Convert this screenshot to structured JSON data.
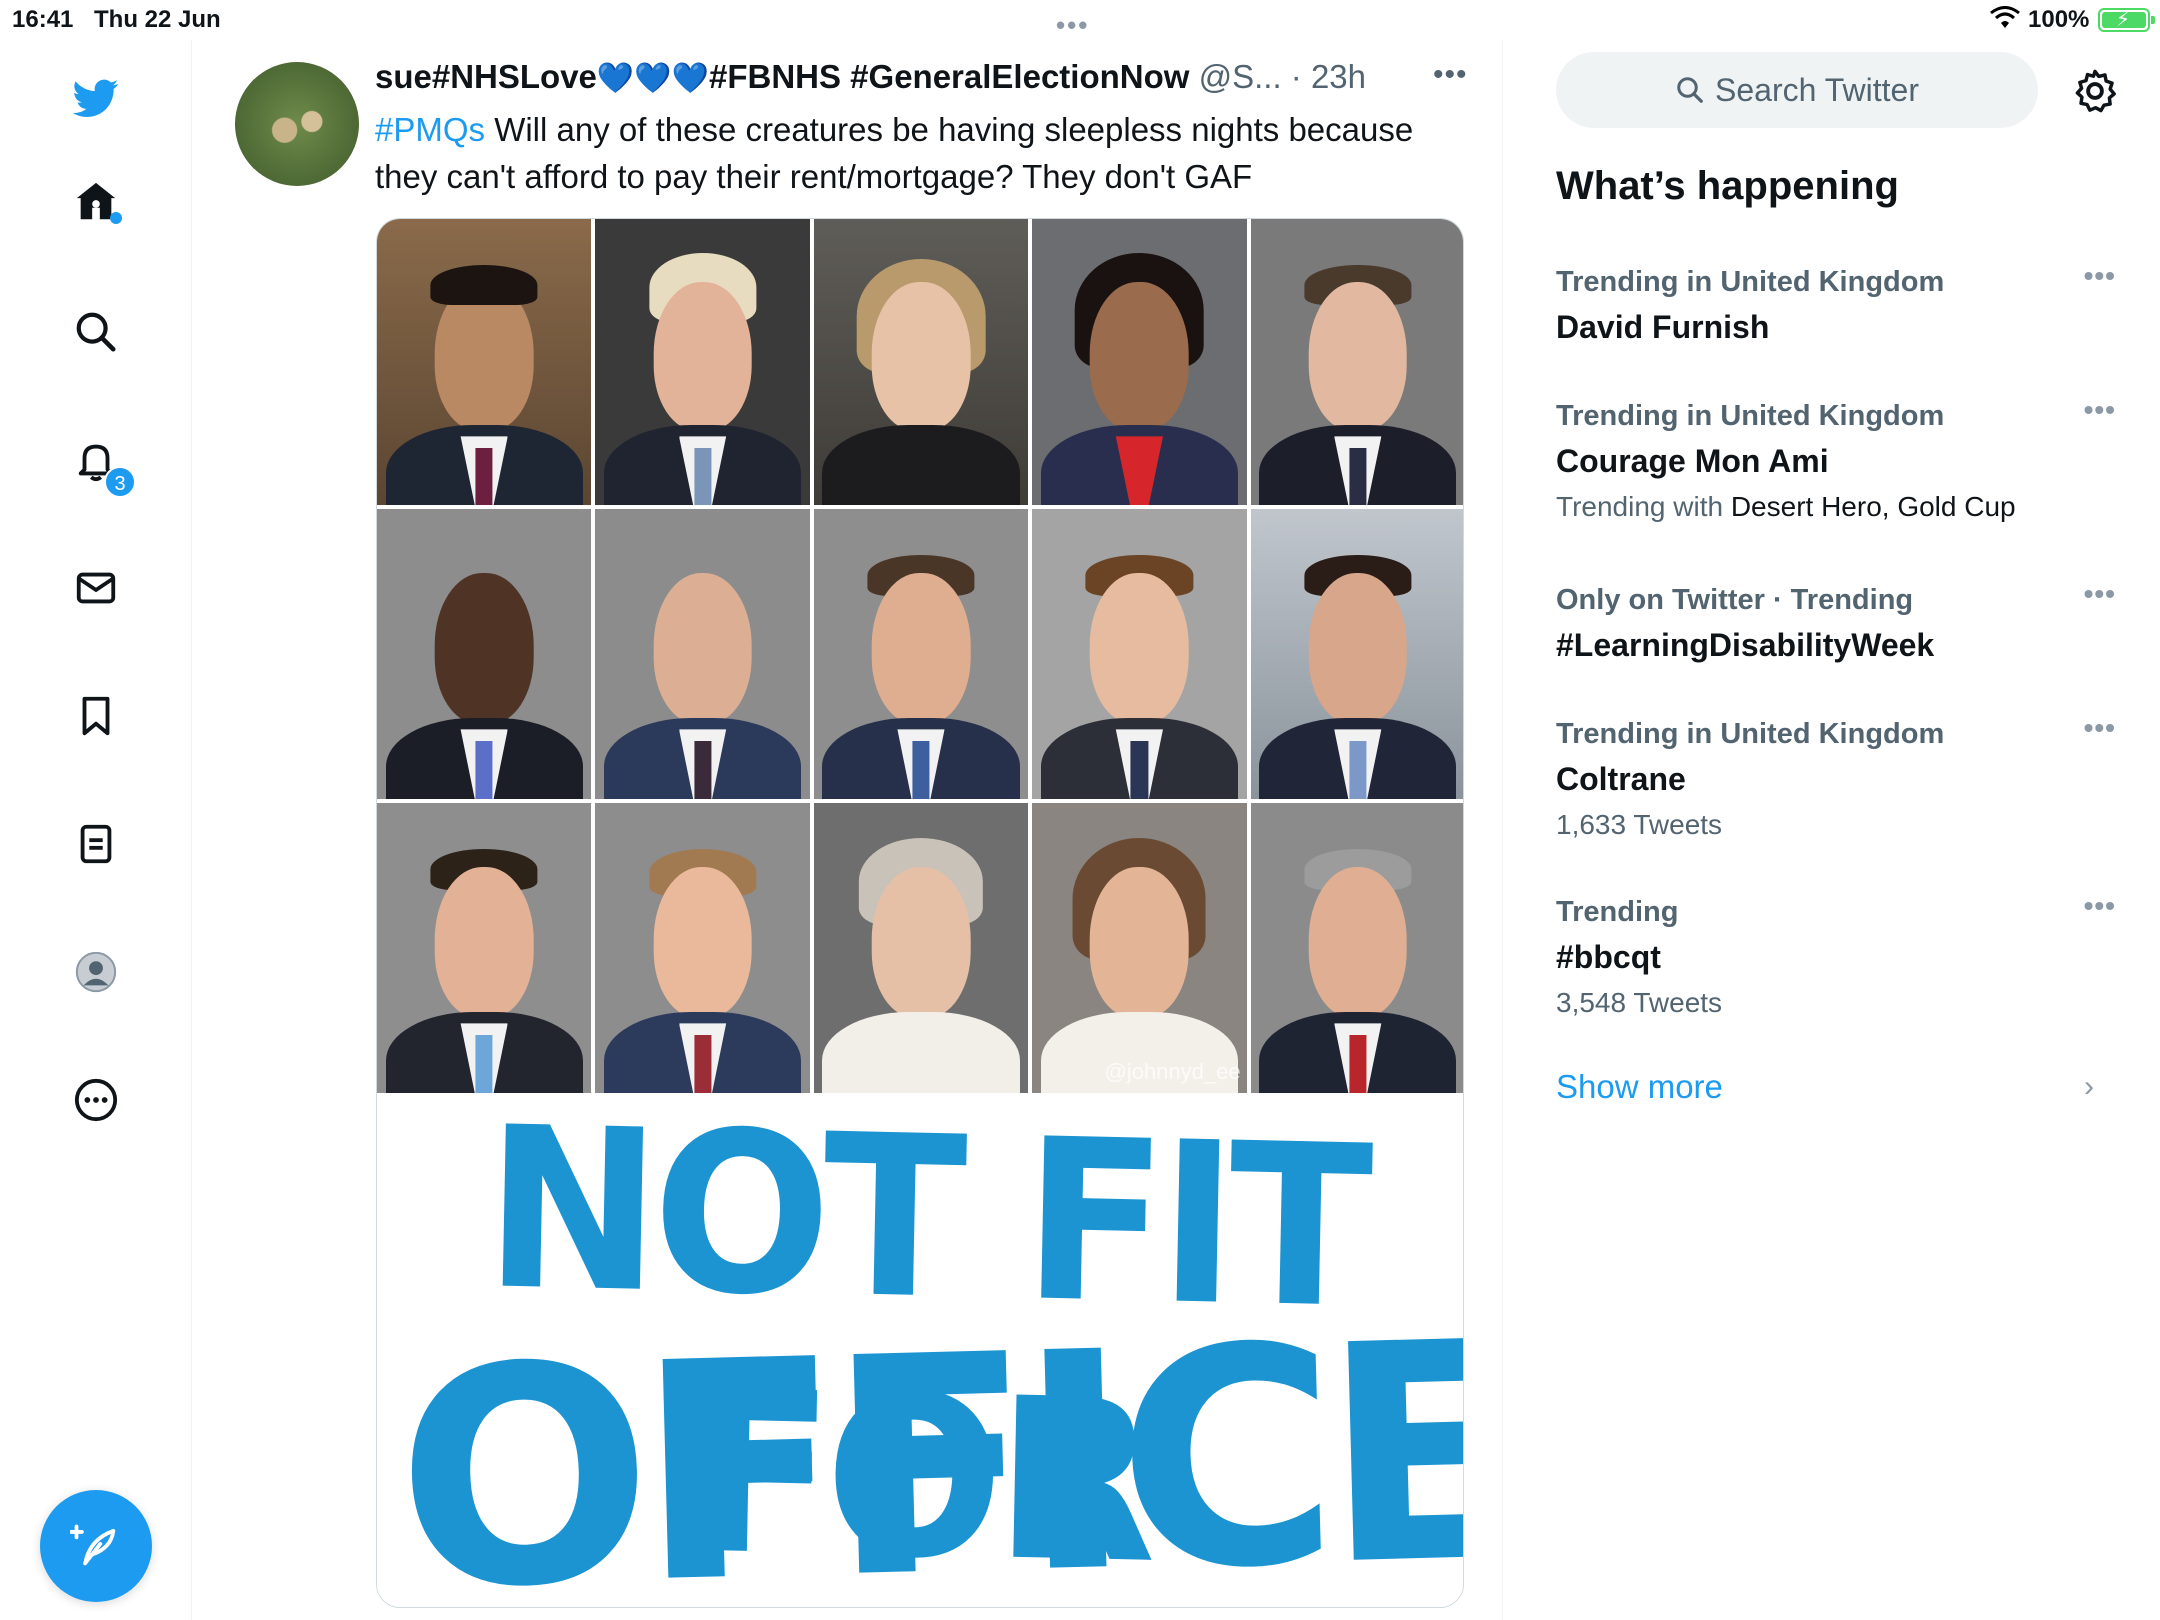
{
  "status_bar": {
    "time": "16:41",
    "date": "Thu 22 Jun",
    "battery": "100%"
  },
  "nav": {
    "notifications_badge": "3",
    "items": [
      "twitter-logo",
      "home-icon",
      "search-icon",
      "bell-icon",
      "mail-icon",
      "bookmark-icon",
      "lists-icon",
      "profile-icon",
      "more-icon"
    ]
  },
  "tweet": {
    "author": "sue#NHSLove",
    "author_tags": "#FBNHS #GeneralElectionNow",
    "handle": "@S...",
    "time": "· 23h",
    "hashtag": "#PMQs",
    "text": " Will any of these creatures be having sleepless nights because they can't afford to pay their rent/mortgage? They don't GAF",
    "media": {
      "watermark": "@johnnyd_ee",
      "slogan_line1": "NOT FIT FOR",
      "slogan_line2": "OFFICE!"
    }
  },
  "sidebar": {
    "search_placeholder": "Search Twitter",
    "heading": "What’s happening",
    "trends": [
      {
        "context": "Trending in United Kingdom",
        "name": "David Furnish",
        "sub_prefix": "",
        "sub_value": ""
      },
      {
        "context": "Trending in United Kingdom",
        "name": "Courage Mon Ami",
        "sub_prefix": "Trending with ",
        "sub_value": "Desert Hero, Gold Cup"
      },
      {
        "context": "Only on Twitter · Trending",
        "name": "#LearningDisabilityWeek",
        "sub_prefix": "",
        "sub_value": ""
      },
      {
        "context": "Trending in United Kingdom",
        "name": "Coltrane",
        "sub_prefix": "1,633 Tweets",
        "sub_value": ""
      },
      {
        "context": "Trending",
        "name": "#bbcqt",
        "sub_prefix": "3,548 Tweets",
        "sub_value": ""
      }
    ],
    "show_more": "Show more"
  },
  "colors": {
    "accent": "#1d9bf0",
    "slogan": "#1c94d2"
  }
}
